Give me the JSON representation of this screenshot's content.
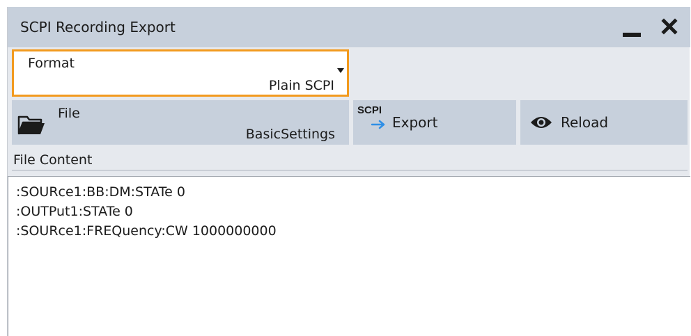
{
  "dialog": {
    "title": "SCPI Recording Export"
  },
  "format": {
    "label": "Format",
    "value": "Plain SCPI"
  },
  "file": {
    "label": "File",
    "value": "BasicSettings"
  },
  "export_button": {
    "icon_text": "SCPI",
    "label": "Export"
  },
  "reload_button": {
    "label": "Reload"
  },
  "file_content": {
    "label": "File Content",
    "lines": [
      ":SOURce1:BB:DM:STATe 0",
      ":OUTPut1:STATe 0",
      ":SOURce1:FREQuency:CW 1000000000"
    ]
  },
  "colors": {
    "accent": "#f29a1e",
    "titlebar": "#c7d0dc",
    "button": "#c7d0dc",
    "arrow": "#2f8fe6"
  },
  "icons": {
    "minimize": "minimize-icon",
    "close": "close-icon",
    "folder": "folder-icon",
    "export": "scpi-export-icon",
    "reload": "eye-icon",
    "dropdown": "dropdown-arrow-icon"
  }
}
